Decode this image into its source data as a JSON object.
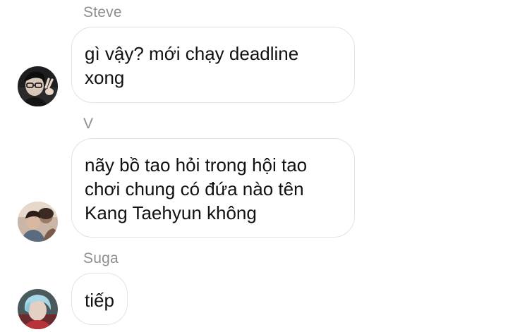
{
  "messages": [
    {
      "sender": "Steve",
      "lines": [
        "gì vậy? mới chạy deadline",
        "xong"
      ],
      "avatar_icon": "profile-photo-icon"
    },
    {
      "sender": "V",
      "lines": [
        "nãy bồ tao hỏi trong hội tao",
        "chơi chung có đứa nào tên",
        "Kang Taehyun không"
      ],
      "avatar_icon": "profile-photo-icon"
    },
    {
      "sender": "Suga",
      "lines": [
        "tiếp"
      ],
      "avatar_icon": "profile-photo-icon"
    }
  ],
  "colors": {
    "sender_text": "#8e8e8e",
    "bubble_border": "#e3e3e3",
    "message_text": "#111111",
    "background": "#ffffff"
  }
}
